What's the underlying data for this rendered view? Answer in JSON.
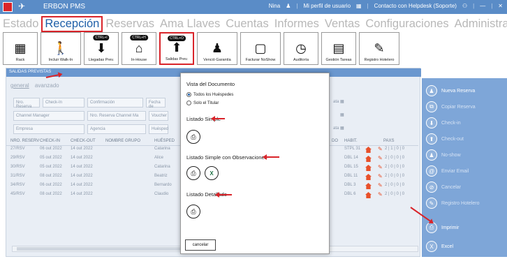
{
  "titlebar": {
    "app_title": "ERBON PMS",
    "user": "Nina",
    "profile": "Mi perfil de usuario",
    "support": "Contacto con Helpdesk (Soporte)",
    "minimize": "—",
    "close": "✕"
  },
  "menu": [
    "Estado",
    "Recepción",
    "Reservas",
    "Ama Llaves",
    "Cuentas",
    "Informes",
    "Ventas",
    "Configuraciones",
    "Administración"
  ],
  "toolbar": [
    {
      "label": "Rack",
      "ctrl": "",
      "icon": "▦"
    },
    {
      "label": "Incluir Walk-In",
      "ctrl": "",
      "icon": "🚶"
    },
    {
      "label": "Llegadas Prev.",
      "ctrl": "CTRL+I",
      "icon": "⬇"
    },
    {
      "label": "In-House",
      "ctrl": "CTRL+H",
      "icon": "⌂"
    },
    {
      "label": "Salidas Prev.",
      "ctrl": "CTRL+O",
      "icon": "⬆"
    },
    {
      "label": "Venció Garantía",
      "ctrl": "",
      "icon": "♟"
    },
    {
      "label": "Facturar NoShow",
      "ctrl": "",
      "icon": "▢"
    },
    {
      "label": "Auditoría",
      "ctrl": "",
      "icon": "◷"
    },
    {
      "label": "Gestión Tareas",
      "ctrl": "",
      "icon": "▤"
    },
    {
      "label": "Registro Hotelero",
      "ctrl": "",
      "icon": "✎"
    }
  ],
  "panel": {
    "title": "SALIDAS PREVISTAS",
    "tab_general": "general",
    "tab_advanced": "avanzado",
    "filters": {
      "row1": [
        "Nro. Reserva",
        "Check-In",
        "Confirmación",
        "Fecha de"
      ],
      "row2": [
        "Channel Manager",
        "Nro. Reserva Channel Ma",
        "Voucher"
      ],
      "row3": [
        "Empresa",
        "Agencia",
        "Huésped"
      ],
      "date_suffix": "ata"
    },
    "columns": [
      "NRO. RESERV",
      "CHECK-IN",
      "CHECK-OUT",
      "NOMBRE GRUPO",
      "HUÉSPED",
      "DO",
      "HABIT.",
      "PAXS"
    ],
    "rows": [
      {
        "nro": "27/RSV",
        "checkin": "06 out 2022",
        "checkout": "14 out 2022",
        "guest": "Catarina",
        "room": "STPL 31",
        "paxs": "2 | 1 | 0 | 0"
      },
      {
        "nro": "29/RSV",
        "checkin": "05 out 2022",
        "checkout": "14 out 2022",
        "guest": "Alice",
        "room": "DBL 14",
        "paxs": "2 | 0 | 0 | 0"
      },
      {
        "nro": "30/RSV",
        "checkin": "05 out 2022",
        "checkout": "14 out 2022",
        "guest": "Catarina",
        "room": "DBL 15",
        "paxs": "2 | 0 | 0 | 0"
      },
      {
        "nro": "31/RSV",
        "checkin": "08 out 2022",
        "checkout": "14 out 2022",
        "guest": "Beatriz",
        "room": "DBL 11",
        "paxs": "2 | 0 | 0 | 0"
      },
      {
        "nro": "34/RSV",
        "checkin": "06 out 2022",
        "checkout": "14 out 2022",
        "guest": "Bernardo",
        "room": "DBL 3",
        "paxs": "2 | 0 | 0 | 0"
      },
      {
        "nro": "45/RSV",
        "checkin": "08 out 2022",
        "checkout": "14 out 2022",
        "guest": "Claudio",
        "room": "DBL 6",
        "paxs": "2 | 0 | 0 | 0"
      }
    ]
  },
  "side_actions": [
    {
      "label": "Nueva Reserva",
      "icon": "♟"
    },
    {
      "label": "Copiar Reserva",
      "icon": "⧉"
    },
    {
      "label": "Check-in",
      "icon": "⬇"
    },
    {
      "label": "Check-out",
      "icon": "⬆"
    },
    {
      "label": "No-show",
      "icon": "♟"
    },
    {
      "label": "Enviar Email",
      "icon": "@"
    },
    {
      "label": "Cancelar",
      "icon": "⊘"
    },
    {
      "label": "Registro Hotelero",
      "icon": "✎"
    },
    {
      "label": "Imprimir",
      "icon": "⎙"
    },
    {
      "label": "Excel",
      "icon": "X"
    }
  ],
  "dialog": {
    "title": "Vista del Documento",
    "radio_all": "Todos los Huéspedes",
    "radio_holder": "Solo el Titular",
    "simple": "Listado Simple",
    "simple_obs": "Listado Simple con Observaciones",
    "detailed": "Listado Detallado",
    "cancel": "cancelar",
    "print_icon": "⎙",
    "excel_icon": "X"
  }
}
